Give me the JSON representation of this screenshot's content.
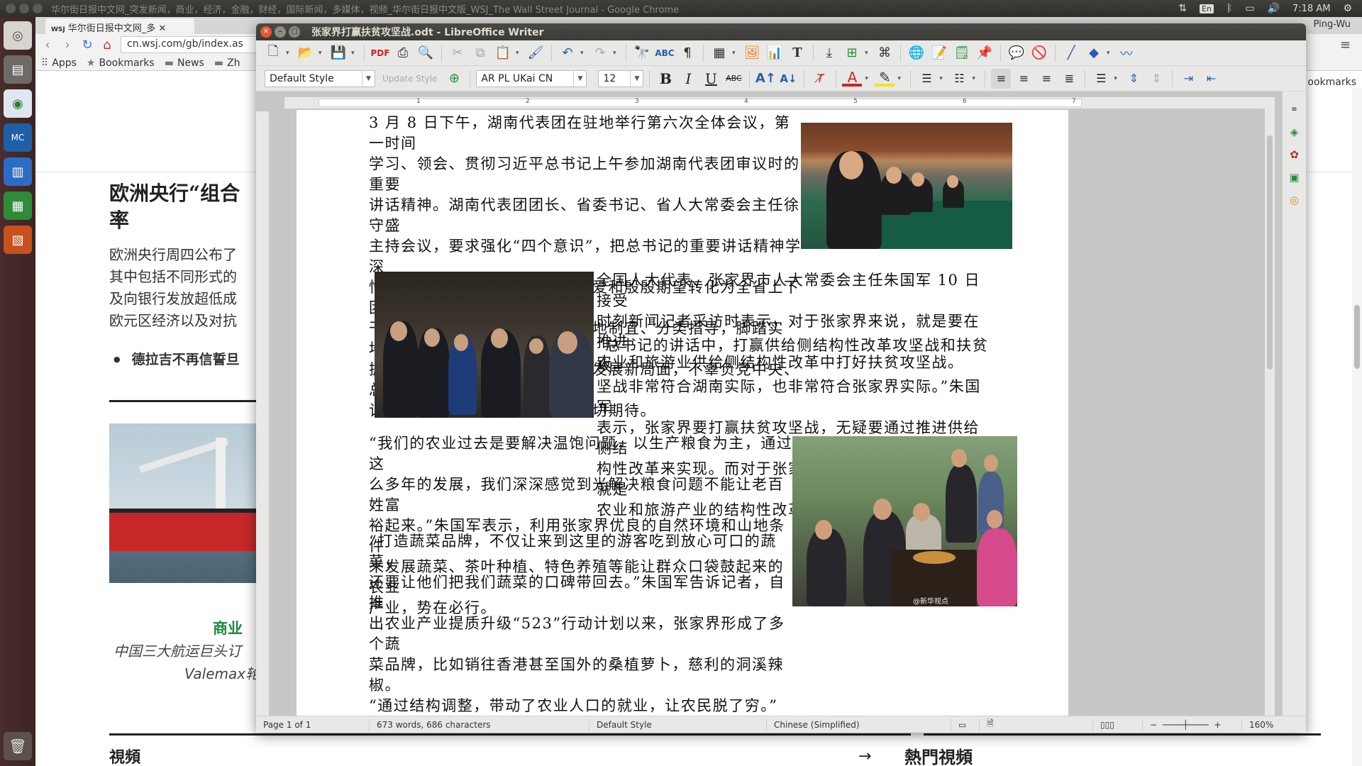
{
  "topbar": {
    "title": "华尔街日报中文网_突发新闻，商业，经济，金融，财经，国际新闻，多媒体，视频_华尔街日报中文版_WSJ_The Wall Street Journal - Google Chrome",
    "lang": "En",
    "time": "7:18 AM"
  },
  "chrome": {
    "tab_title": "华尔街日报中文网_多",
    "tab_logo": "WSJ",
    "user": "Ping-Wu",
    "url": "cn.wsj.com/gb/index.as",
    "bookmarks": [
      "Apps",
      "Bookmarks",
      "News",
      "Zh"
    ],
    "bookmarks_right": "ookmarks"
  },
  "wsj_page": {
    "headline": "欧洲央行“组合率",
    "headline_l1": "欧洲央行“组合",
    "headline_l2": "率",
    "body_lines": [
      "欧洲央行周四公布了",
      "其中包括不同形式的",
      "及向银行发放超低成",
      "欧元区经济以及对抗"
    ],
    "bullet": "德拉吉不再信誓旦",
    "category": "商业",
    "caption_l1": "中国三大航运巨头订",
    "caption_l2": "Valemax轮",
    "section_left": "視頻",
    "section_arrow": "→",
    "section_right": "熱門視頻"
  },
  "writer": {
    "title": "张家界打赢扶贫攻坚战.odt - LibreOffice Writer",
    "para_style": "Default Style",
    "update_style": "Update Style",
    "font_name": "AR PL UKai CN",
    "font_size": "12",
    "ruler_nums": [
      "1",
      "2",
      "3",
      "4",
      "5",
      "6",
      "7"
    ],
    "paragraphs": {
      "p1": [
        "3 月 8 日下午，湖南代表团在驻地举行第六次全体会议，第一时间",
        "学习、领会、贯彻习近平总书记上午参加湖南代表团审议时的重要",
        "讲话精神。湖南代表团团长、省委书记、省人大常委会主任徐守盛",
        "主持会议，要求强化“四个意识”，把总书记的重要讲话精神学深",
        "悟透，把总书记对湖南的关怀厚爱和殷殷期望转化为全省上下团结",
        "干事、奋发进取的生动实践，因地制宜、分类指导，脚踏实地、真",
        "抓实干，不断开创全省各项事业发展新局面，不辜负党中央、总书",
        "记的重托，不辜负全省人民的殷切期待。"
      ],
      "p2": [
        "全国人大代表、张家界市人大常委会主任朱国军 10 日接受",
        "时刻新闻记者采访时表示，对于张家界来说，就是要在推进",
        "农业和旅游业供给侧结构性改革中打好扶贫攻坚战。"
      ],
      "p3": [
        "“总书记的讲话中，打赢供给侧结构性改革攻坚战和扶贫攻",
        "坚战非常符合湖南实际，也非常符合张家界实际。”朱国军",
        "表示，张家界要打赢扶贫攻坚战，无疑要通过推进供给侧结",
        "构性改革来实现。而对于张家界来说，结构性改革主要就是",
        "农业和旅游产业的结构性改革问题。"
      ],
      "p4": [
        "“我们的农业过去是要解决温饱问题，以生产粮食为主，通过这",
        "么多年的发展，我们深深感觉到光解决粮食问题不能让老百姓富",
        "裕起来。”朱国军表示，利用张家界优良的自然环境和山地条件",
        "来发展蔬菜、茶叶种植、特色养殖等能让群众口袋鼓起来的农业",
        "产业，势在必行。"
      ],
      "p5": [
        "“打造蔬菜品牌，不仅让来到这里的游客吃到放心可口的蔬菜，",
        "还要让他们把我们蔬菜的口碑带回去。”朱国军告诉记者，自推",
        "出农业产业提质升级“523”行动计划以来，张家界形成了多个蔬",
        "菜品牌，比如销往香港甚至国外的桑植萝卜，慈利的洞溪辣椒。",
        "“通过结构调整，带动了农业人口的就业，让农民脱了穷。”"
      ]
    },
    "photo_watermark": "@新华视点",
    "status": {
      "page": "Page 1 of 1",
      "words": "673 words, 686 characters",
      "style": "Default Style",
      "language": "Chinese (Simplified)",
      "zoom": "160%"
    }
  },
  "colors": {
    "libre_close": "#e9572c",
    "wsj_category": "#1a8a3a",
    "launcher_bg": "#4a2d2c"
  }
}
